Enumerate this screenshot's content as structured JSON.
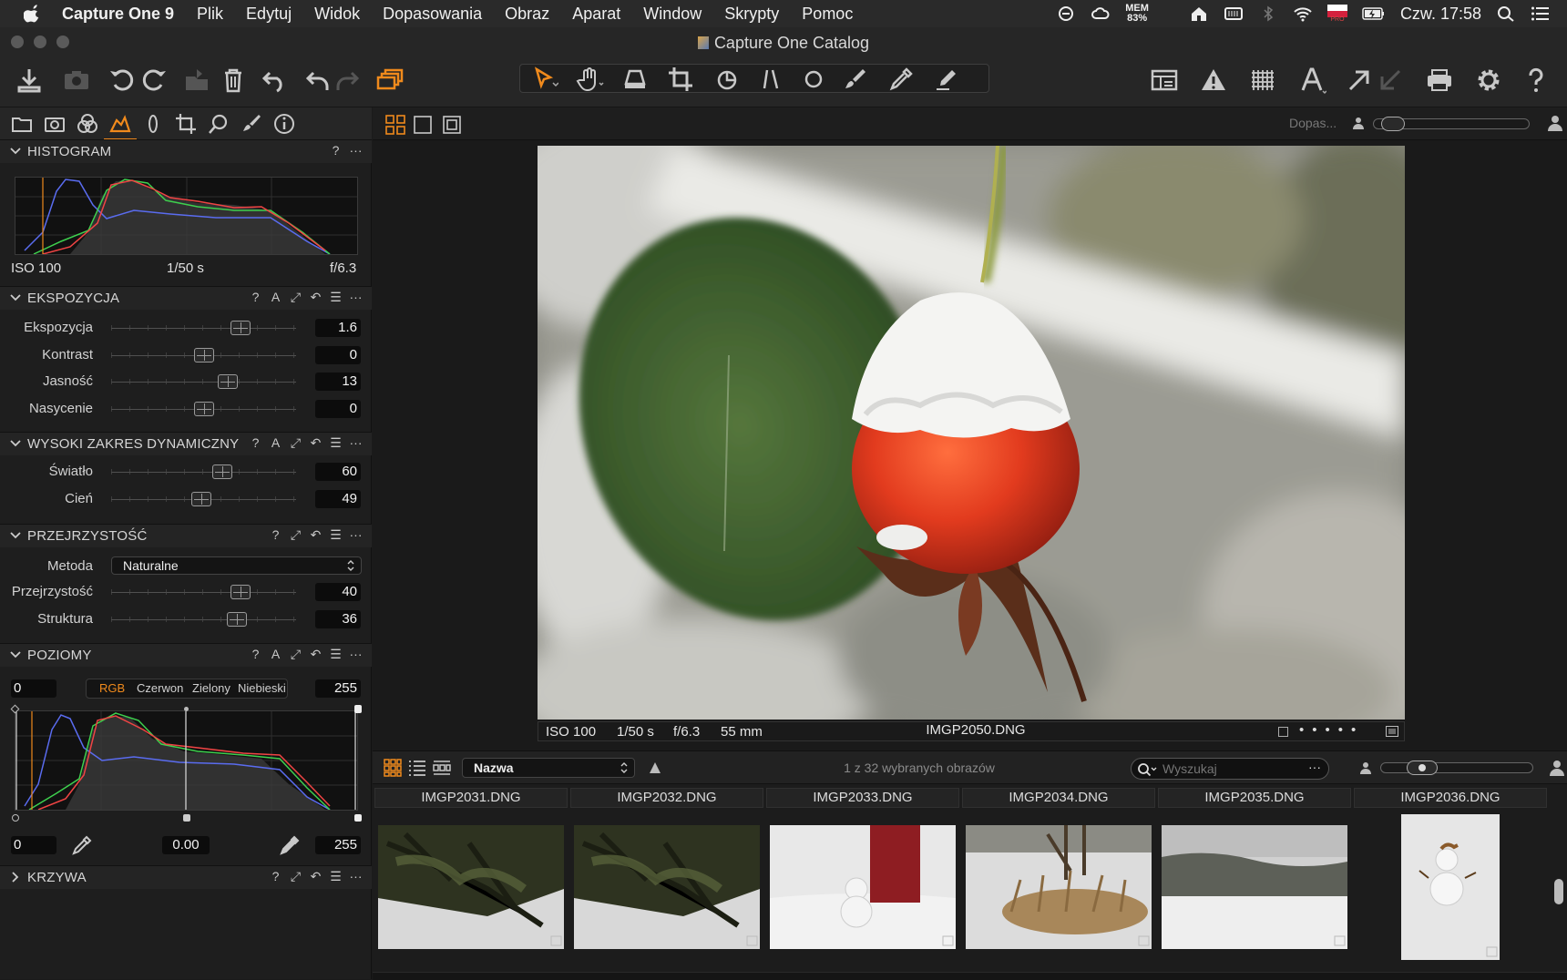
{
  "menubar": {
    "app_name": "Capture One 9",
    "items": [
      "Plik",
      "Edytuj",
      "Widok",
      "Dopasowania",
      "Obraz",
      "Aparat",
      "Window",
      "Skrypty",
      "Pomoc"
    ],
    "mem_label": "MEM",
    "mem_value": "83%",
    "clock": "Czw. 17:58",
    "flag_label": "PRO"
  },
  "window": {
    "title": "Capture One Catalog"
  },
  "viewer_toolbar": {
    "adjust_label": "Dopas..."
  },
  "histogram": {
    "title": "HISTOGRAM",
    "iso": "ISO 100",
    "shutter": "1/50 s",
    "aperture": "f/6.3"
  },
  "exposure": {
    "title": "EKSPOZYCJA",
    "sliders": [
      {
        "label": "Ekspozycja",
        "value": "1.6",
        "pos": 0.7
      },
      {
        "label": "Kontrast",
        "value": "0",
        "pos": 0.5
      },
      {
        "label": "Jasność",
        "value": "13",
        "pos": 0.63
      },
      {
        "label": "Nasycenie",
        "value": "0",
        "pos": 0.5
      }
    ]
  },
  "hdr": {
    "title": "WYSOKI ZAKRES DYNAMICZNY",
    "sliders": [
      {
        "label": "Światło",
        "value": "60",
        "pos": 0.6
      },
      {
        "label": "Cień",
        "value": "49",
        "pos": 0.49
      }
    ]
  },
  "clarity": {
    "title": "PRZEJRZYSTOŚĆ",
    "method_label": "Metoda",
    "method_value": "Naturalne",
    "sliders": [
      {
        "label": "Przejrzystość",
        "value": "40",
        "pos": 0.7
      },
      {
        "label": "Struktura",
        "value": "36",
        "pos": 0.68
      }
    ]
  },
  "levels": {
    "title": "POZIOMY",
    "input_low": "0",
    "input_high": "255",
    "channels": [
      "RGB",
      "Czerwon",
      "Zielony",
      "Niebieski"
    ],
    "output_low": "0",
    "midpoint": "0.00",
    "output_high": "255"
  },
  "curve": {
    "title": "KRZYWA"
  },
  "photo_info": {
    "iso": "ISO 100",
    "shutter": "1/50 s",
    "aperture": "f/6.3",
    "focal": "55 mm",
    "filename": "IMGP2050.DNG"
  },
  "browser": {
    "sort_value": "Nazwa",
    "selection_text": "1 z 32 wybranych obrazów",
    "search_placeholder": "Wyszukaj",
    "files": [
      "IMGP2031.DNG",
      "IMGP2032.DNG",
      "IMGP2033.DNG",
      "IMGP2034.DNG",
      "IMGP2035.DNG",
      "IMGP2036.DNG"
    ]
  },
  "colors": {
    "accent": "#f08a1c",
    "panel_bg": "#1e1e1e",
    "toolbar_bg": "#262626"
  }
}
